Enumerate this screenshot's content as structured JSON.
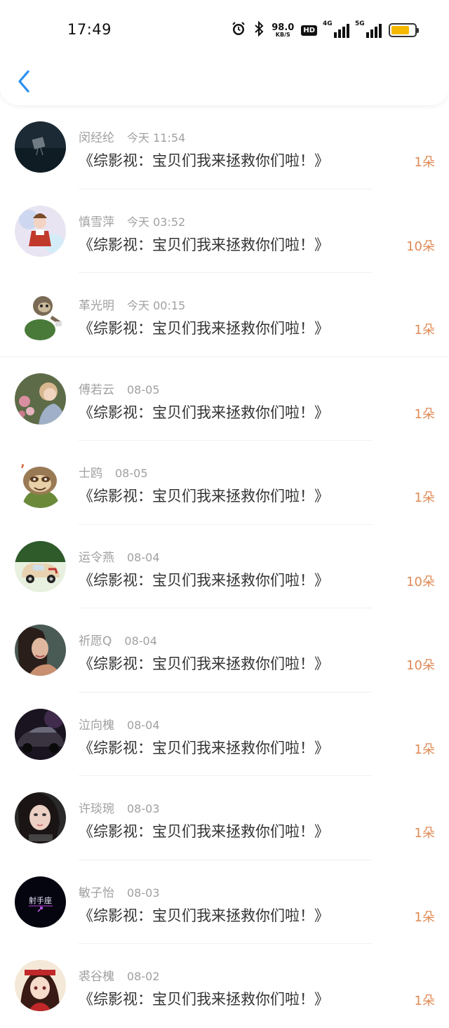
{
  "status_bar": {
    "time": "17:49",
    "net_speed": "98.0",
    "net_unit": "KB/S",
    "hd_label": "HD",
    "sig1_label": "4G",
    "sig2_label": "5G",
    "battery_color": "#f5b800"
  },
  "header": {
    "back_icon": "chevron-left-icon",
    "accent": "#2b8ff0"
  },
  "items": [
    {
      "name": "闵经纶",
      "time": "今天 11:54",
      "text": "《综影视：宝贝们我来拯救你们啦！》",
      "count": "1朵",
      "avatar": "dark-scene"
    },
    {
      "name": "慎雪萍",
      "time": "今天 03:52",
      "text": "《综影视：宝贝们我来拯救你们啦！》",
      "count": "10朵",
      "avatar": "anime-girl-red"
    },
    {
      "name": "革光明",
      "time": "今天 00:15",
      "text": "《综影视：宝贝们我来拯救你们啦！》",
      "count": "1朵",
      "avatar": "sloth-cartoon"
    },
    {
      "name": "傅若云",
      "time": "08-05",
      "text": "《综影视：宝贝们我来拯救你们啦！》",
      "count": "1朵",
      "avatar": "woman-flowers"
    },
    {
      "name": "士鸥",
      "time": "08-05",
      "text": "《综影视：宝贝们我来拯救你们啦！》",
      "count": "1朵",
      "avatar": "sloth-face"
    },
    {
      "name": "运令燕",
      "time": "08-04",
      "text": "《综影视：宝贝们我来拯救你们啦！》",
      "count": "10朵",
      "avatar": "toy-car"
    },
    {
      "name": "祈愿Q",
      "time": "08-04",
      "text": "《综影视：宝贝们我来拯救你们啦！》",
      "count": "10朵",
      "avatar": "girl-portrait"
    },
    {
      "name": "泣向槐",
      "time": "08-04",
      "text": "《综影视：宝贝们我来拯救你们啦！》",
      "count": "1朵",
      "avatar": "dark-car"
    },
    {
      "name": "许琰琬",
      "time": "08-03",
      "text": "《综影视：宝贝们我来拯救你们啦！》",
      "count": "1朵",
      "avatar": "girl-closeup"
    },
    {
      "name": "敏子怡",
      "time": "08-03",
      "text": "《综影视：宝贝们我来拯救你们啦！》",
      "count": "1朵",
      "avatar": "neon-logo",
      "avatar_text": "射手座"
    },
    {
      "name": "裘谷槐",
      "time": "08-02",
      "text": "《综影视：宝贝们我来拯救你们啦！》",
      "count": "1朵",
      "avatar": "anime-girl-dark"
    }
  ]
}
